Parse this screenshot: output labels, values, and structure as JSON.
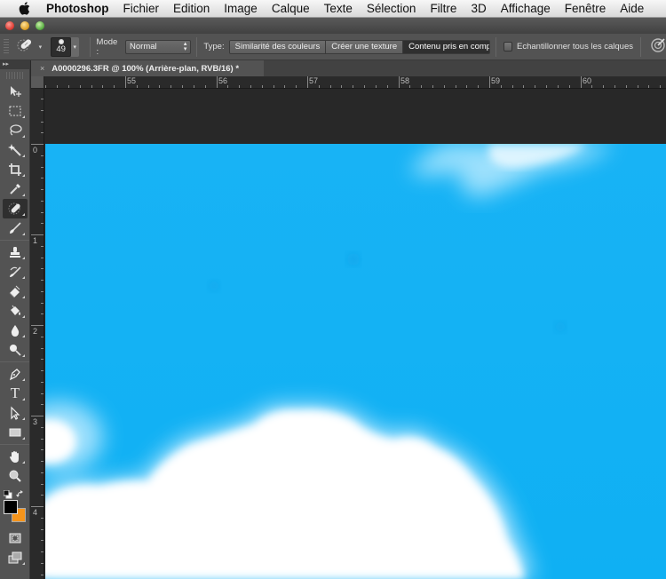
{
  "menubar": {
    "apple_icon": "apple-logo-icon",
    "items": [
      "Photoshop",
      "Fichier",
      "Edition",
      "Image",
      "Calque",
      "Texte",
      "Sélection",
      "Filtre",
      "3D",
      "Affichage",
      "Fenêtre",
      "Aide"
    ]
  },
  "window": {
    "controls": [
      "close",
      "minimize",
      "zoom"
    ]
  },
  "options_bar": {
    "tool_icon": "spot-healing-brush-icon",
    "brush_size": "49",
    "mode_label": "Mode :",
    "mode_value": "Normal",
    "type_label": "Type:",
    "type_options": [
      {
        "label": "Similarité des couleurs",
        "active": false
      },
      {
        "label": "Créer une texture",
        "active": false
      },
      {
        "label": "Contenu pris en compte",
        "active": true
      }
    ],
    "sample_all_layers_label": "Echantillonner tous les calques",
    "sample_all_layers_checked": false,
    "pressure_icon": "tablet-pressure-icon"
  },
  "document": {
    "tab_title": "A0000296.3FR @ 100% (Arrière-plan, RVB/16) *",
    "close_label": "×"
  },
  "rulers": {
    "horizontal_labels": [
      "55",
      "56",
      "57",
      "58",
      "59",
      "60"
    ],
    "vertical_labels": [
      "0",
      "1",
      "2",
      "3",
      "4"
    ]
  },
  "tools": [
    {
      "name": "move-tool",
      "icon": "move-icon"
    },
    {
      "name": "rectangular-marquee-tool",
      "icon": "marquee-icon"
    },
    {
      "name": "lasso-tool",
      "icon": "lasso-icon"
    },
    {
      "name": "magic-wand-tool",
      "icon": "magic-wand-icon"
    },
    {
      "name": "crop-tool",
      "icon": "crop-icon"
    },
    {
      "name": "eyedropper-tool",
      "icon": "eyedropper-icon"
    },
    {
      "name": "spot-healing-brush-tool",
      "icon": "healing-brush-icon",
      "active": true
    },
    {
      "name": "brush-tool",
      "icon": "brush-icon"
    },
    {
      "name": "clone-stamp-tool",
      "icon": "stamp-icon"
    },
    {
      "name": "history-brush-tool",
      "icon": "history-brush-icon"
    },
    {
      "name": "eraser-tool",
      "icon": "eraser-icon"
    },
    {
      "name": "paint-bucket-tool",
      "icon": "paint-bucket-icon"
    },
    {
      "name": "blur-tool",
      "icon": "blur-drop-icon"
    },
    {
      "name": "dodge-tool",
      "icon": "dodge-icon"
    },
    {
      "name": "pen-tool",
      "icon": "pen-icon"
    },
    {
      "name": "type-tool",
      "icon": "type-icon"
    },
    {
      "name": "path-selection-tool",
      "icon": "path-selection-icon"
    },
    {
      "name": "rectangle-tool",
      "icon": "rectangle-icon"
    },
    {
      "name": "hand-tool",
      "icon": "hand-icon"
    },
    {
      "name": "zoom-tool",
      "icon": "zoom-icon"
    }
  ],
  "colors": {
    "foreground": "#000000",
    "background": "#f5941b",
    "canvas_sky": "#13b1f4"
  },
  "type_glyph": "T"
}
